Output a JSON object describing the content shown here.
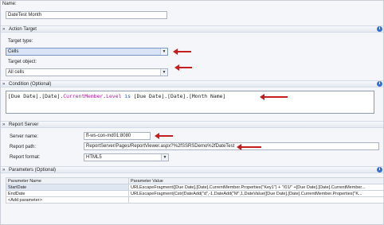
{
  "name": {
    "label": "Name:",
    "value": "DateTest Month"
  },
  "action_target": {
    "header": "Action Target",
    "target_type_label": "Target type:",
    "target_type_value": "Cells",
    "target_object_label": "Target object:",
    "target_object_value": "All cells"
  },
  "condition": {
    "header": "Condition (Optional)",
    "tokens": {
      "t1": "[Due Date].[Date].",
      "t2": "CurrentMember",
      "t3": ".",
      "t4": "Level",
      "t5": " ",
      "t6": "is",
      "t7": " [Due Date].[Date].[Month Name]"
    }
  },
  "report_server": {
    "header": "Report Server",
    "server_name_label": "Server name:",
    "server_name_value": "ff-ws-con-md01:8080",
    "report_path_label": "Report path:",
    "report_path_value": "ReportServer/Pages/ReportViewer.aspx?%2fSSRSDemo%2fDateTest",
    "report_format_label": "Report format:",
    "report_format_value": "HTML5"
  },
  "parameters": {
    "header": "Parameters (Optional)",
    "col_name": "Parameter Name",
    "col_value": "Parameter Value",
    "rows": [
      {
        "name": "StartDate",
        "value": "URLEscapeFragment([Due Date].[Date].CurrentMember.Properties(\"Key1\") + \"/01/\" +[Due Date].[Date].CurrentMember..."
      },
      {
        "name": "EndDate",
        "value": "URLEscapeFragment(Cstr(DateAdd(\"d\",-1,DateAdd(\"M\",1,DateValue([Due Date].[Date].CurrentMember.Properties(\"K..."
      }
    ],
    "add_label": "<Add parameter>"
  },
  "icons": {
    "collapse": "chevron-double-up-icon",
    "info": "info-icon",
    "dropdown": "chevron-down-icon",
    "annotation": "red-arrow-annotation"
  },
  "colors": {
    "annotation_arrow": "#c41e1e",
    "keyword": "#1d4fd4",
    "member": "#b3169e",
    "info_icon": "#2f6fd6"
  }
}
